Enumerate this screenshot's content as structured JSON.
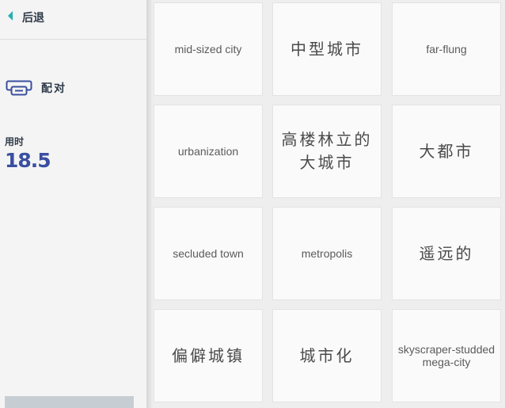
{
  "sidebar": {
    "back_label": "后退",
    "mode_label": "配对",
    "time_label": "用时",
    "time_value": "18.5"
  },
  "cards": [
    {
      "text": "mid-sized city",
      "lang": "en"
    },
    {
      "text": "中型城市",
      "lang": "zh"
    },
    {
      "text": "far-flung",
      "lang": "en"
    },
    {
      "text": "urbanization",
      "lang": "en"
    },
    {
      "text": "高楼林立的大城市",
      "lang": "zh"
    },
    {
      "text": "大都市",
      "lang": "zh"
    },
    {
      "text": "secluded town",
      "lang": "en"
    },
    {
      "text": "metropolis",
      "lang": "en"
    },
    {
      "text": "遥远的",
      "lang": "zh"
    },
    {
      "text": "偏僻城镇",
      "lang": "zh"
    },
    {
      "text": "城市化",
      "lang": "zh"
    },
    {
      "text": "skyscraper-studded mega-city",
      "lang": "en"
    }
  ],
  "colors": {
    "accent": "#24b0b4",
    "time_value": "#3a4fa0",
    "mode_icon": "#3a4fa0",
    "bottom_bar": "#c7ced3"
  },
  "icons": {
    "back": "caret-left-icon",
    "mode": "card-match-icon"
  }
}
